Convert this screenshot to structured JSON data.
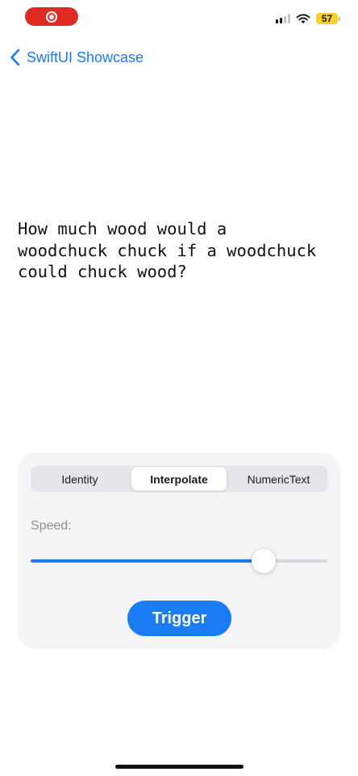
{
  "status_bar": {
    "battery_level": "57",
    "battery_color": "#f6d12a",
    "recording_color": "#e02b24",
    "icons": [
      "record-icon",
      "cellular-signal-icon",
      "wifi-icon",
      "battery-icon"
    ]
  },
  "nav": {
    "back_label": "SwiftUI Showcase",
    "back_icon": "chevron-left-icon",
    "accent_color": "#1a7cf3"
  },
  "content": {
    "text": "How much wood would a\nwoodchuck chuck if a woodchuck\ncould chuck wood?"
  },
  "controls": {
    "segments": [
      {
        "label": "Identity",
        "selected": false
      },
      {
        "label": "Interpolate",
        "selected": true
      },
      {
        "label": "NumericText",
        "selected": false
      }
    ],
    "speed_label": "Speed:",
    "speed_value_fraction": 0.81,
    "trigger_label": "Trigger"
  }
}
